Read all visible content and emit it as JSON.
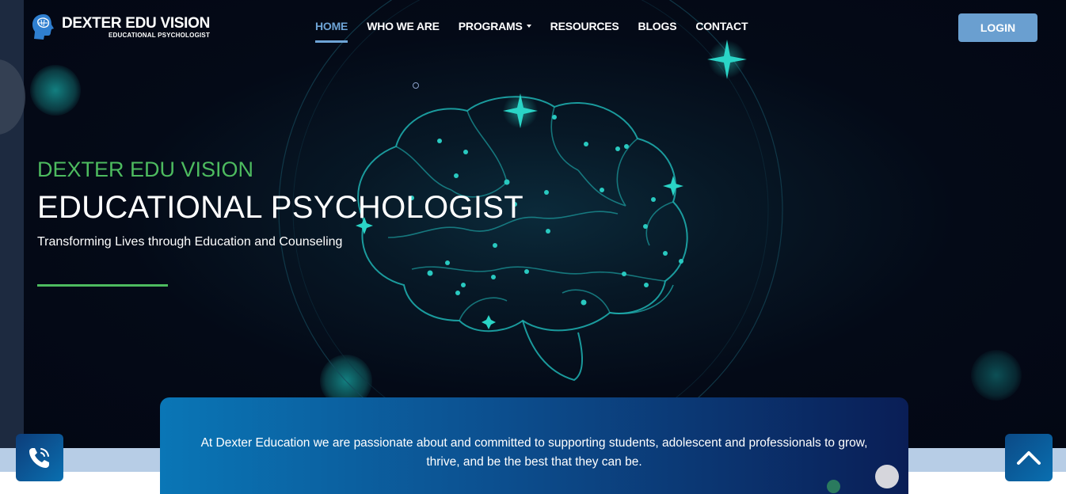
{
  "brand": {
    "title": "DEXTER EDU VISION",
    "subtitle": "EDUCATIONAL PSYCHOLOGIST",
    "icon": "brain-head-icon"
  },
  "nav": {
    "items": [
      {
        "label": "HOME",
        "active": true
      },
      {
        "label": "WHO WE ARE",
        "active": false
      },
      {
        "label": "PROGRAMS",
        "active": false,
        "has_dropdown": true
      },
      {
        "label": "RESOURCES",
        "active": false
      },
      {
        "label": "BLOGS",
        "active": false
      },
      {
        "label": "CONTACT",
        "active": false
      }
    ],
    "login_label": "LOGIN"
  },
  "hero": {
    "kicker": "DEXTER EDU VISION",
    "title": "EDUCATIONAL PSYCHOLOGIST",
    "tagline": "Transforming Lives through Education and Counseling"
  },
  "info": {
    "text": "At Dexter Education we are passionate about and committed to supporting students, adolescent and professionals to grow, thrive, and be the best that they can be."
  },
  "floating": {
    "call_icon": "phone-call-icon",
    "top_icon": "chevron-up-icon"
  },
  "colors": {
    "accent_green": "#4dbb5f",
    "nav_active": "#6ea4d6",
    "login_bg": "#6a9fd0",
    "hero_bg": "#040a17",
    "brain_line": "#1fb3b3"
  }
}
